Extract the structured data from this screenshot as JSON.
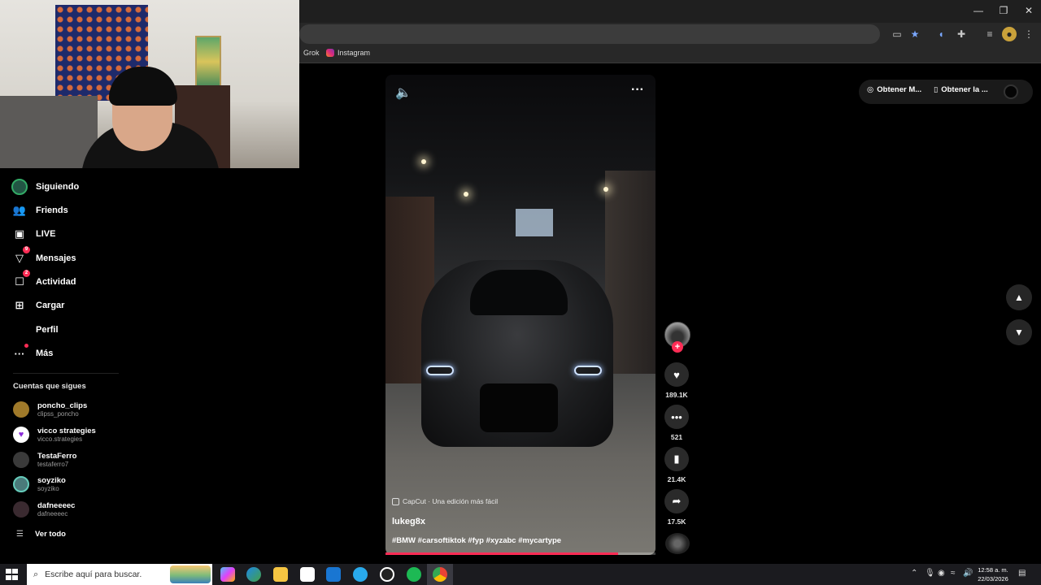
{
  "window": {
    "minimize": "—",
    "restore": "❐",
    "close": "✕"
  },
  "bookmarks": [
    {
      "label": "Grok"
    },
    {
      "label": "Instagram"
    }
  ],
  "sidebar": {
    "nav": [
      {
        "label": "Siguiendo",
        "icon": "following-avatar-icon"
      },
      {
        "label": "Friends",
        "icon": "friends-icon"
      },
      {
        "label": "LIVE",
        "icon": "live-icon"
      },
      {
        "label": "Mensajes",
        "icon": "messages-icon",
        "badge": "9"
      },
      {
        "label": "Actividad",
        "icon": "activity-icon",
        "badge": "2"
      },
      {
        "label": "Cargar",
        "icon": "upload-icon"
      },
      {
        "label": "Perfil",
        "icon": "profile-icon"
      },
      {
        "label": "Más",
        "icon": "more-icon"
      }
    ],
    "following_title": "Cuentas que sigues",
    "accounts": [
      {
        "name": "poncho_clips",
        "handle": "clipss_poncho",
        "color": "#a07a2a"
      },
      {
        "name": "vicco strategies",
        "handle": "vicco.strategies",
        "color": "#8a2bd8"
      },
      {
        "name": "TestaFerro",
        "handle": "testaferro7",
        "color": "#3a3a3a"
      },
      {
        "name": "soyziko",
        "handle": "soyziko",
        "color": "#4a7a7a"
      },
      {
        "name": "dafneeeec",
        "handle": "dafneeeec",
        "color": "#3a2a30"
      }
    ],
    "see_all": "Ver todo"
  },
  "video": {
    "capcut": "CapCut · Una edición más fácil",
    "author": "lukeg8x",
    "tags": "#BMW #carsoftiktok #fyp #xyzabc #mycartype",
    "progress": 0.86
  },
  "actions": {
    "likes": "189.1K",
    "comments": "521",
    "saves": "21.4K",
    "shares": "17.5K"
  },
  "top_right": {
    "get_app_1": "Obtener M...",
    "get_app_2": "Obtener la ..."
  },
  "taskbar": {
    "search_placeholder": "Escribe aquí para buscar.",
    "time": "12:58 a. m.",
    "date": "22/03/2026"
  },
  "colors": {
    "accent": "#fe2c55",
    "background": "#000000"
  }
}
